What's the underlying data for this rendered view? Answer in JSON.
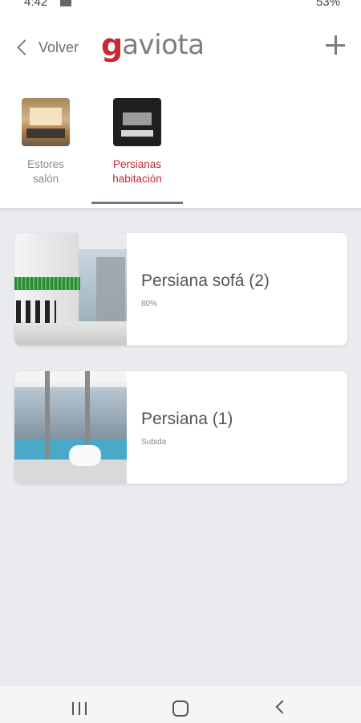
{
  "status_bar": {
    "time": "4:42",
    "battery": "53%"
  },
  "header": {
    "back_label": "Volver",
    "logo_g": "g",
    "logo_rest": "aviota"
  },
  "rooms": [
    {
      "label": "Estores\nsalón",
      "icon": "living-room-photo",
      "active": false
    },
    {
      "label": "Persianas\nhabitación",
      "icon": "bedroom-photo",
      "active": true
    }
  ],
  "devices": [
    {
      "title": "Persiana sofá (2)",
      "status": "80%"
    },
    {
      "title": "Persiana (1)",
      "status": "Subida"
    }
  ],
  "colors": {
    "accent": "#c82832",
    "tab_indicator": "#6b7a8f",
    "background": "#e9ebef"
  }
}
